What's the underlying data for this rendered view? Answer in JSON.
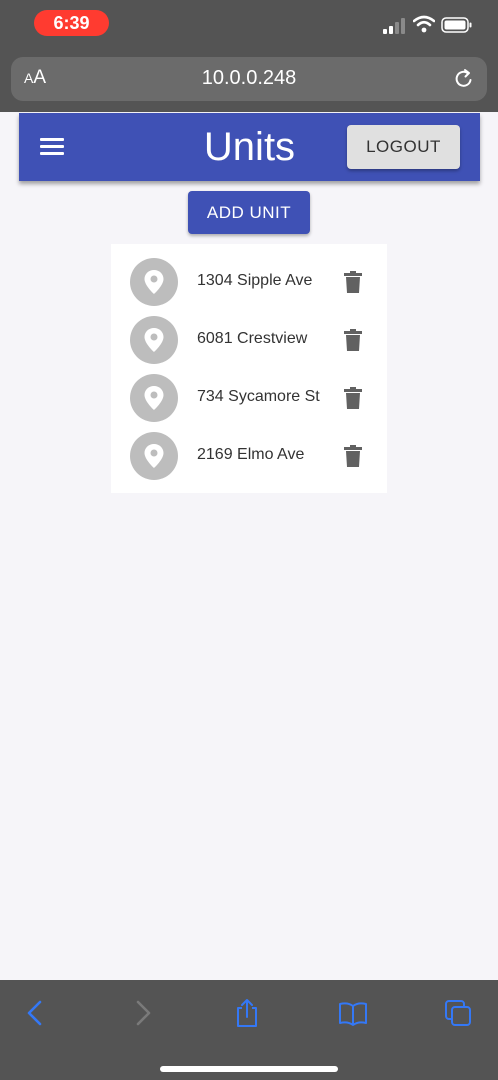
{
  "status_bar": {
    "time": "6:39"
  },
  "browser": {
    "text_size_label_small": "A",
    "text_size_label_large": "A",
    "url": "10.0.0.248"
  },
  "header": {
    "title": "Units",
    "logout_label": "LOGOUT"
  },
  "actions": {
    "add_unit_label": "ADD UNIT"
  },
  "units": [
    {
      "label": "1304 Sipple Ave",
      "icon": "location-pin-icon"
    },
    {
      "label": "6081 Crestview",
      "icon": "location-pin-icon"
    },
    {
      "label": "734 Sycamore St",
      "icon": "location-pin-icon"
    },
    {
      "label": "2169 Elmo Ave",
      "icon": "location-pin-icon"
    }
  ],
  "toolbar": {
    "icons": [
      "back-icon",
      "forward-icon",
      "share-icon",
      "bookmarks-icon",
      "tabs-icon"
    ]
  },
  "colors": {
    "primary": "#3f51b5",
    "status_pill": "#ff3b30",
    "browser_chrome": "#545454",
    "avatar": "#bdbdbd",
    "toolbar_icon": "#3478f6"
  }
}
